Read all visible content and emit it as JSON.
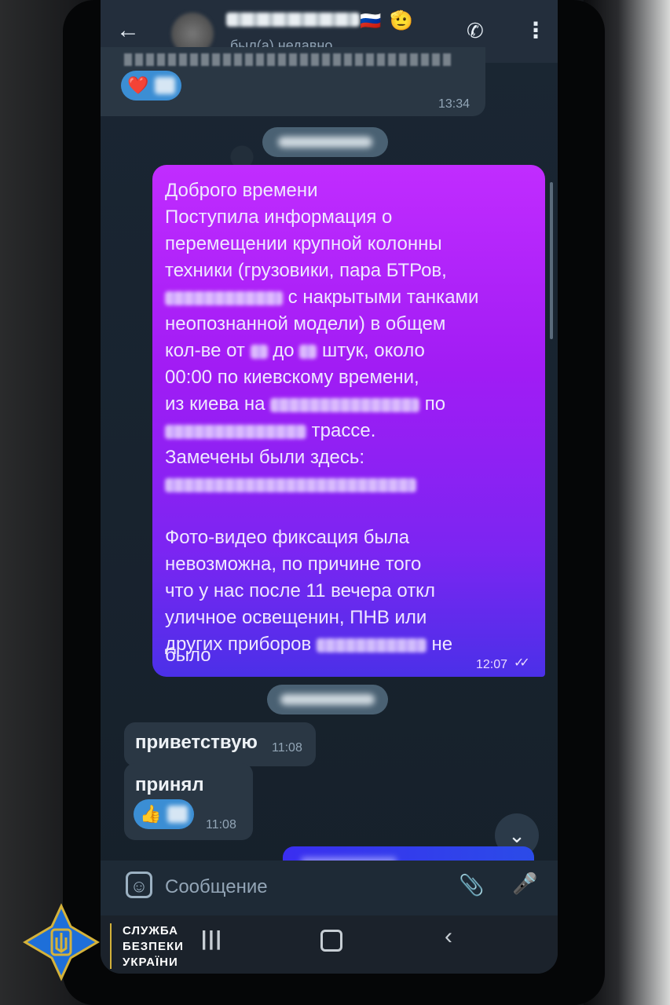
{
  "header": {
    "back_icon": "arrow-left-icon",
    "status": "был(а) недавно",
    "flag": "🇷🇺",
    "emoji": "🫡",
    "call_icon": "phone-icon",
    "more_icon": "more-vertical-icon"
  },
  "messages": {
    "top_time": "13:34",
    "out_lines": [
      "Доброго времени",
      "Поступила информация о",
      "перемещении крупной колонны",
      "техники (грузовики, пара БТРов,",
      "с накрытыми танками",
      "неопознанной модели) в общем",
      "кол-ве от",
      "до",
      "штук, около",
      "00:00 по киевскому времени,",
      "из киева на",
      "по",
      "трассе.",
      "Замечены были здесь:",
      "Фото-видео фиксация была",
      "невозможна, по причине того",
      "что у нас после 11 вечера откл",
      "уличное освещенин, ПНВ или",
      "других приборов",
      "не",
      "было"
    ],
    "out_time": "12:07",
    "greet_text": "приветствую",
    "greet_time": "11:08",
    "received_text": "принял",
    "received_time": "11:08"
  },
  "input": {
    "placeholder": "Сообщение"
  },
  "logo": {
    "line1": "СЛУЖБА",
    "line2": "БЕЗПЕКИ",
    "line3": "УКРАЇНИ"
  },
  "colors": {
    "accent_out_start": "#c12cff",
    "accent_out_end": "#4b30e8",
    "reaction": "#3b8ed4",
    "logo": "#1e6fd9"
  }
}
